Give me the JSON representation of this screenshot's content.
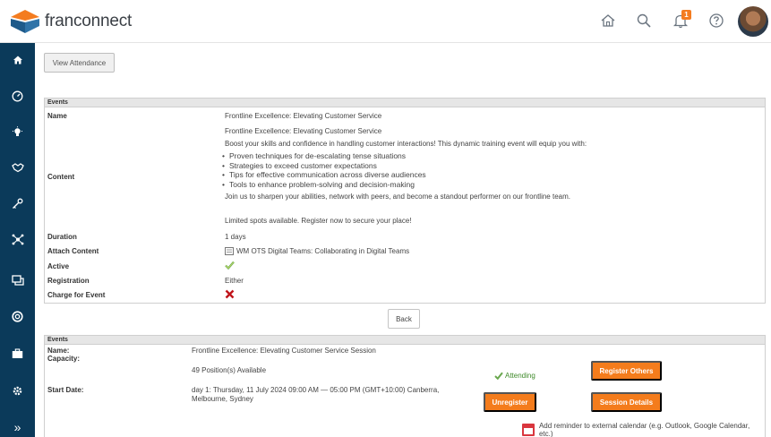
{
  "brand": {
    "name_prefix": "fran",
    "name_suffix": "connect"
  },
  "topbar": {
    "icons": [
      "home-icon",
      "search-icon",
      "bell-icon",
      "help-icon"
    ],
    "notification_count": "1"
  },
  "sidebar": {
    "icons": [
      "home-icon",
      "dashboard-icon",
      "lightbulb-icon",
      "handshake-icon",
      "key-icon",
      "network-icon",
      "chat-icon",
      "lifebuoy-icon",
      "briefcase-icon",
      "gear-icon",
      "expand-icon"
    ],
    "expand_glyph": "»"
  },
  "actions": {
    "view_attendance": "View Attendance",
    "back": "Back"
  },
  "event": {
    "section_title": "Events",
    "name_label": "Name",
    "name_value": "Frontline Excellence: Elevating Customer Service",
    "content_label": "Content",
    "content_title": "Frontline Excellence: Elevating Customer Service",
    "content_intro": "Boost your skills and confidence in handling customer interactions! This dynamic training event will equip you with:",
    "content_points": [
      "Proven techniques for de-escalating tense situations",
      "Strategies to exceed customer expectations",
      "Tips for effective communication across diverse audiences",
      "Tools to enhance problem-solving and decision-making"
    ],
    "content_join": "Join us to sharpen your abilities, network with peers, and become a standout performer on our frontline team.",
    "content_limited": "Limited spots available. Register now to secure your place!",
    "duration_label": "Duration",
    "duration_value": "1 days",
    "attach_label": "Attach Content",
    "attach_value": "WM OTS Digital Teams: Collaborating in Digital Teams",
    "active_label": "Active",
    "registration_label": "Registration",
    "registration_value": "Either",
    "charge_label": "Charge for Event"
  },
  "session": {
    "section_title": "Events",
    "name_label": "Name:",
    "name_value": "Frontline Excellence: Elevating Customer Service Session",
    "capacity_label": "Capacity:",
    "capacity_value": "49 Position(s) Available",
    "attending": "Attending",
    "register_others": "Register Others",
    "start_label": "Start Date:",
    "start_value_line1": "day 1: Thursday, 11 July 2024 09:00 AM — 05:00 PM (GMT+10:00) Canberra,",
    "start_value_line2": "Melbourne, Sydney",
    "unregister": "Unregister",
    "session_details": "Session Details",
    "reminder": "Add reminder to external calendar (e.g. Outlook, Google Calendar, etc.)"
  },
  "colors": {
    "sidebar": "#0b3a5a",
    "accent": "#f47c1c",
    "logo_orange": "#f47c20",
    "logo_blue": "#1e5a8a"
  }
}
